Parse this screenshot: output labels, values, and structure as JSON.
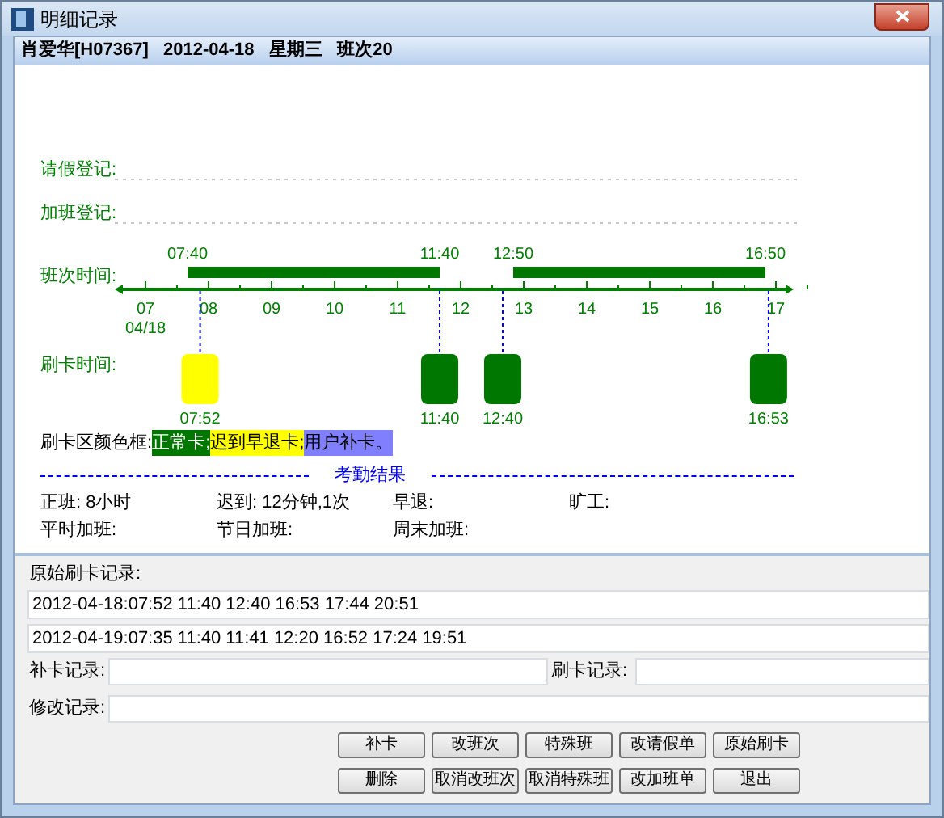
{
  "window": {
    "title": "明细记录"
  },
  "header": "肖爱华[H07367]   2012-04-18   星期三   班次20",
  "rows": [
    {
      "label": "请假登记:"
    },
    {
      "label": "加班登记:"
    }
  ],
  "timeline": {
    "shift_label": "班次时间:",
    "punch_label": "刷卡时间:",
    "date": "04/18",
    "hours": [
      "07",
      "08",
      "09",
      "10",
      "11",
      "12",
      "13",
      "14",
      "15",
      "16",
      "17"
    ],
    "shifts": [
      {
        "start": "07:40",
        "end": "11:40"
      },
      {
        "start": "12:50",
        "end": "16:50"
      }
    ],
    "punches": [
      {
        "time": "07:52",
        "color": "#ffff00"
      },
      {
        "time": "11:40",
        "color": "#007800"
      },
      {
        "time": "12:40",
        "color": "#007800"
      },
      {
        "time": "16:53",
        "color": "#007800"
      }
    ]
  },
  "legend": {
    "label": "刷卡区颜色框:",
    "items": [
      {
        "text": "正常卡;",
        "color": "#007800"
      },
      {
        "text": "迟到早退卡;",
        "color": "#ffff00"
      },
      {
        "text": "用户补卡。",
        "color": "#8080ff"
      }
    ]
  },
  "results": {
    "title": "考勤结果",
    "rows": [
      [
        {
          "label": "正班:",
          "value": "8小时"
        },
        {
          "label": "迟到:",
          "value": "12分钟,1次"
        },
        {
          "label": "早退:"
        },
        {
          "label": "旷工:"
        }
      ],
      [
        {
          "label": "平时加班:"
        },
        {
          "label": "节日加班:"
        },
        {
          "label": "周末加班:"
        }
      ]
    ]
  },
  "raw_records": {
    "label": "原始刷卡记录:",
    "lines": [
      "2012-04-18:07:52 11:40 12:40 16:53 17:44 20:51",
      "2012-04-19:07:35 11:40 11:41 12:20 16:52 17:24 19:51"
    ]
  },
  "fields": {
    "makeup": "补卡记录:",
    "swipe": "刷卡记录:",
    "edit": "修改记录:"
  },
  "buttons": [
    [
      "补卡",
      "改班次",
      "特殊班",
      "改请假单",
      "原始刷卡"
    ],
    [
      "删除",
      "取消改班次",
      "取消特殊班",
      "改加班单",
      "退出"
    ]
  ]
}
